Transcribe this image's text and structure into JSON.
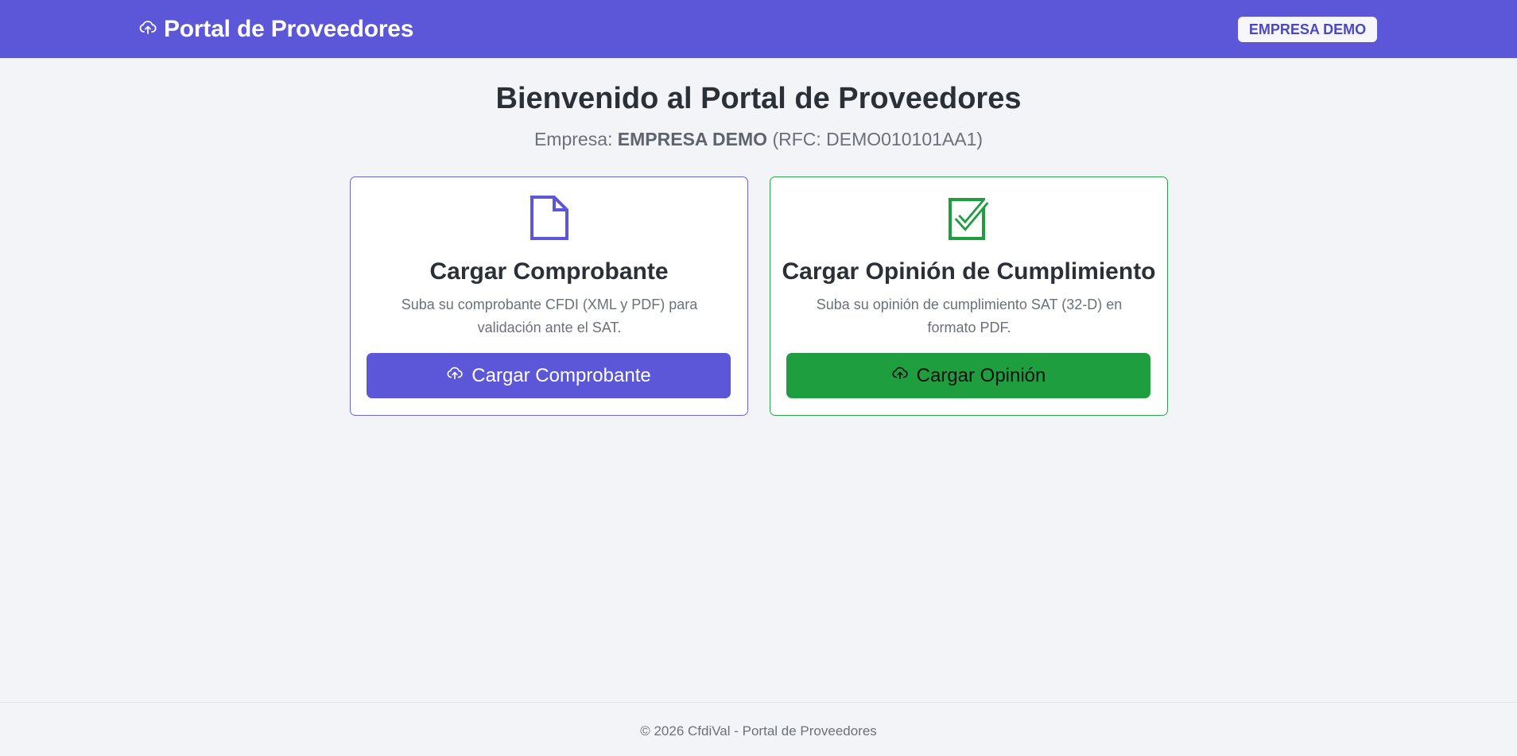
{
  "navbar": {
    "brand_title": "Portal de Proveedores",
    "brand_icon": "cloud-upload-icon",
    "company_badge": "EMPRESA DEMO"
  },
  "main": {
    "title": "Bienvenido al Portal de Proveedores",
    "company_prefix": "Empresa:",
    "company_name": "EMPRESA DEMO",
    "company_rfc": "(RFC: DEMO010101AA1)"
  },
  "cards": [
    {
      "icon": "document-icon",
      "title": "Cargar Comprobante",
      "description": "Suba su comprobante CFDI (XML y PDF) para validación ante el SAT.",
      "button_label": "Cargar Comprobante",
      "button_icon": "cloud-upload-icon",
      "accent": "#5b57d8"
    },
    {
      "icon": "check-square-icon",
      "title": "Cargar Opinión de Cumplimiento",
      "description": "Suba su opinión de cumplimiento SAT (32-D) en formato PDF.",
      "button_label": "Cargar Opinión",
      "button_icon": "cloud-upload-icon",
      "accent": "#1e9e3e"
    }
  ],
  "footer": {
    "text": "© 2026 CfdiVal - Portal de Proveedores"
  },
  "colors": {
    "navbar": "#5b57d8",
    "background": "#f3f4f7",
    "primary": "#5b57d8",
    "success": "#1e9e3e"
  }
}
